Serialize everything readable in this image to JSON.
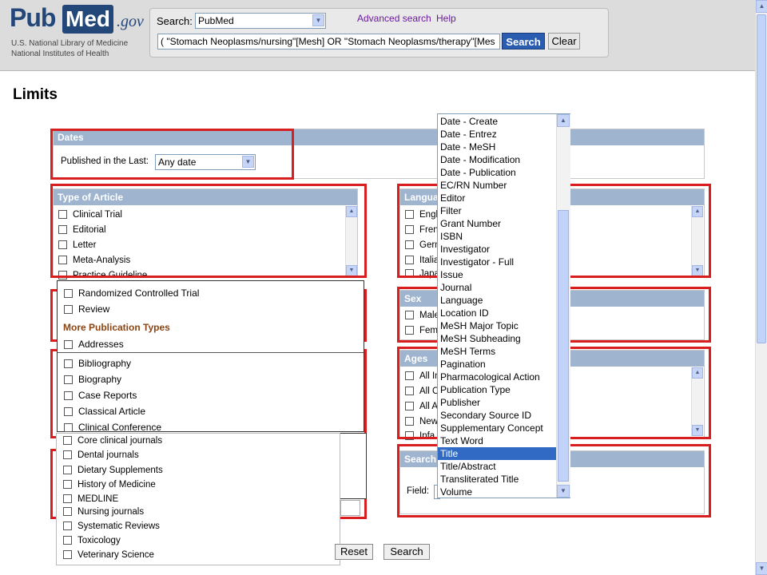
{
  "header": {
    "logo_pub": "Pub",
    "logo_med": "Med",
    "logo_gov": ".gov",
    "nlm_line1": "U.S. National Library of Medicine",
    "nlm_line2": "National Institutes of Health",
    "search_label": "Search:",
    "db_value": "PubMed",
    "advanced_link": "Advanced search",
    "help_link": "Help",
    "query": "( \"Stomach Neoplasms/nursing\"[Mesh] OR \"Stomach Neoplasms/therapy\"[Mes",
    "search_button": "Search",
    "clear_button": "Clear"
  },
  "page_title": "Limits",
  "dates": {
    "header": "Dates",
    "label": "Published in the Last:",
    "value": "Any date"
  },
  "type_of_article": {
    "header": "Type of Article",
    "items": [
      "Clinical Trial",
      "Editorial",
      "Letter",
      "Meta-Analysis",
      "Practice Guideline"
    ]
  },
  "type_popup": {
    "items_top": [
      "Randomized Controlled Trial",
      "Review"
    ],
    "more_label": "More Publication Types",
    "items_more": [
      "Addresses",
      "Bibliography",
      "Biography",
      "Case Reports",
      "Classical Article",
      "Clinical Conference"
    ]
  },
  "journal_popup": {
    "items": [
      "Core clinical journals",
      "Dental journals",
      "Dietary Supplements",
      "History of Medicine",
      "MEDLINE",
      "Nursing journals",
      "Systematic Reviews",
      "Toxicology",
      "Veterinary Science"
    ]
  },
  "languages": {
    "header": "Langua",
    "items": [
      "Engl",
      "Frenc",
      "Germ",
      "Italia",
      "Japa"
    ]
  },
  "sex": {
    "header": "Sex",
    "items": [
      "Male",
      "Fema"
    ]
  },
  "ages": {
    "header": "Ages",
    "items": [
      "All In",
      "All C",
      "All A",
      "New",
      "Infa"
    ]
  },
  "search_field": {
    "header": "Search",
    "label": "Field:"
  },
  "field_list": {
    "items": [
      "Date - Create",
      "Date - Entrez",
      "Date - MeSH",
      "Date - Modification",
      "Date - Publication",
      "EC/RN Number",
      "Editor",
      "Filter",
      "Grant Number",
      "ISBN",
      "Investigator",
      "Investigator - Full",
      "Issue",
      "Journal",
      "Language",
      "Location ID",
      "MeSH Major Topic",
      "MeSH Subheading",
      "MeSH Terms",
      "Pagination",
      "Pharmacological Action",
      "Publication Type",
      "Publisher",
      "Secondary Source ID",
      "Supplementary Concept",
      "Text Word",
      "Title",
      "Title/Abstract",
      "Transliterated Title",
      "Volume"
    ],
    "selected": "Title"
  },
  "footer": {
    "reset_button": "Reset",
    "search_button": "Search"
  }
}
